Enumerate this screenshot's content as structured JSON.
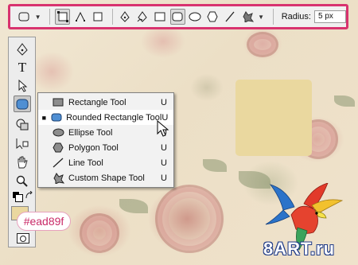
{
  "options_bar": {
    "radius_label": "Radius:",
    "radius_value": "5 px",
    "accent_color": "#d8336f"
  },
  "tools": [
    "pen-tool",
    "type-tool",
    "path-selection-tool",
    "rounded-rectangle-tool",
    "clone-stamp-tool",
    "path-select-tool",
    "hand-tool",
    "zoom-tool"
  ],
  "flyout": {
    "items": [
      {
        "label": "Rectangle Tool",
        "key": "U",
        "icon": "rectangle-icon"
      },
      {
        "label": "Rounded Rectangle Tool",
        "key": "U",
        "icon": "rounded-rectangle-icon",
        "selected": true
      },
      {
        "label": "Ellipse Tool",
        "key": "U",
        "icon": "ellipse-icon"
      },
      {
        "label": "Polygon Tool",
        "key": "U",
        "icon": "polygon-icon"
      },
      {
        "label": "Line Tool",
        "key": "U",
        "icon": "line-icon"
      },
      {
        "label": "Custom Shape Tool",
        "key": "U",
        "icon": "custom-shape-icon"
      }
    ]
  },
  "color_tag": "#ead89f",
  "shape_fill": "#ead89f",
  "logo": {
    "text": "8ART.ru"
  }
}
